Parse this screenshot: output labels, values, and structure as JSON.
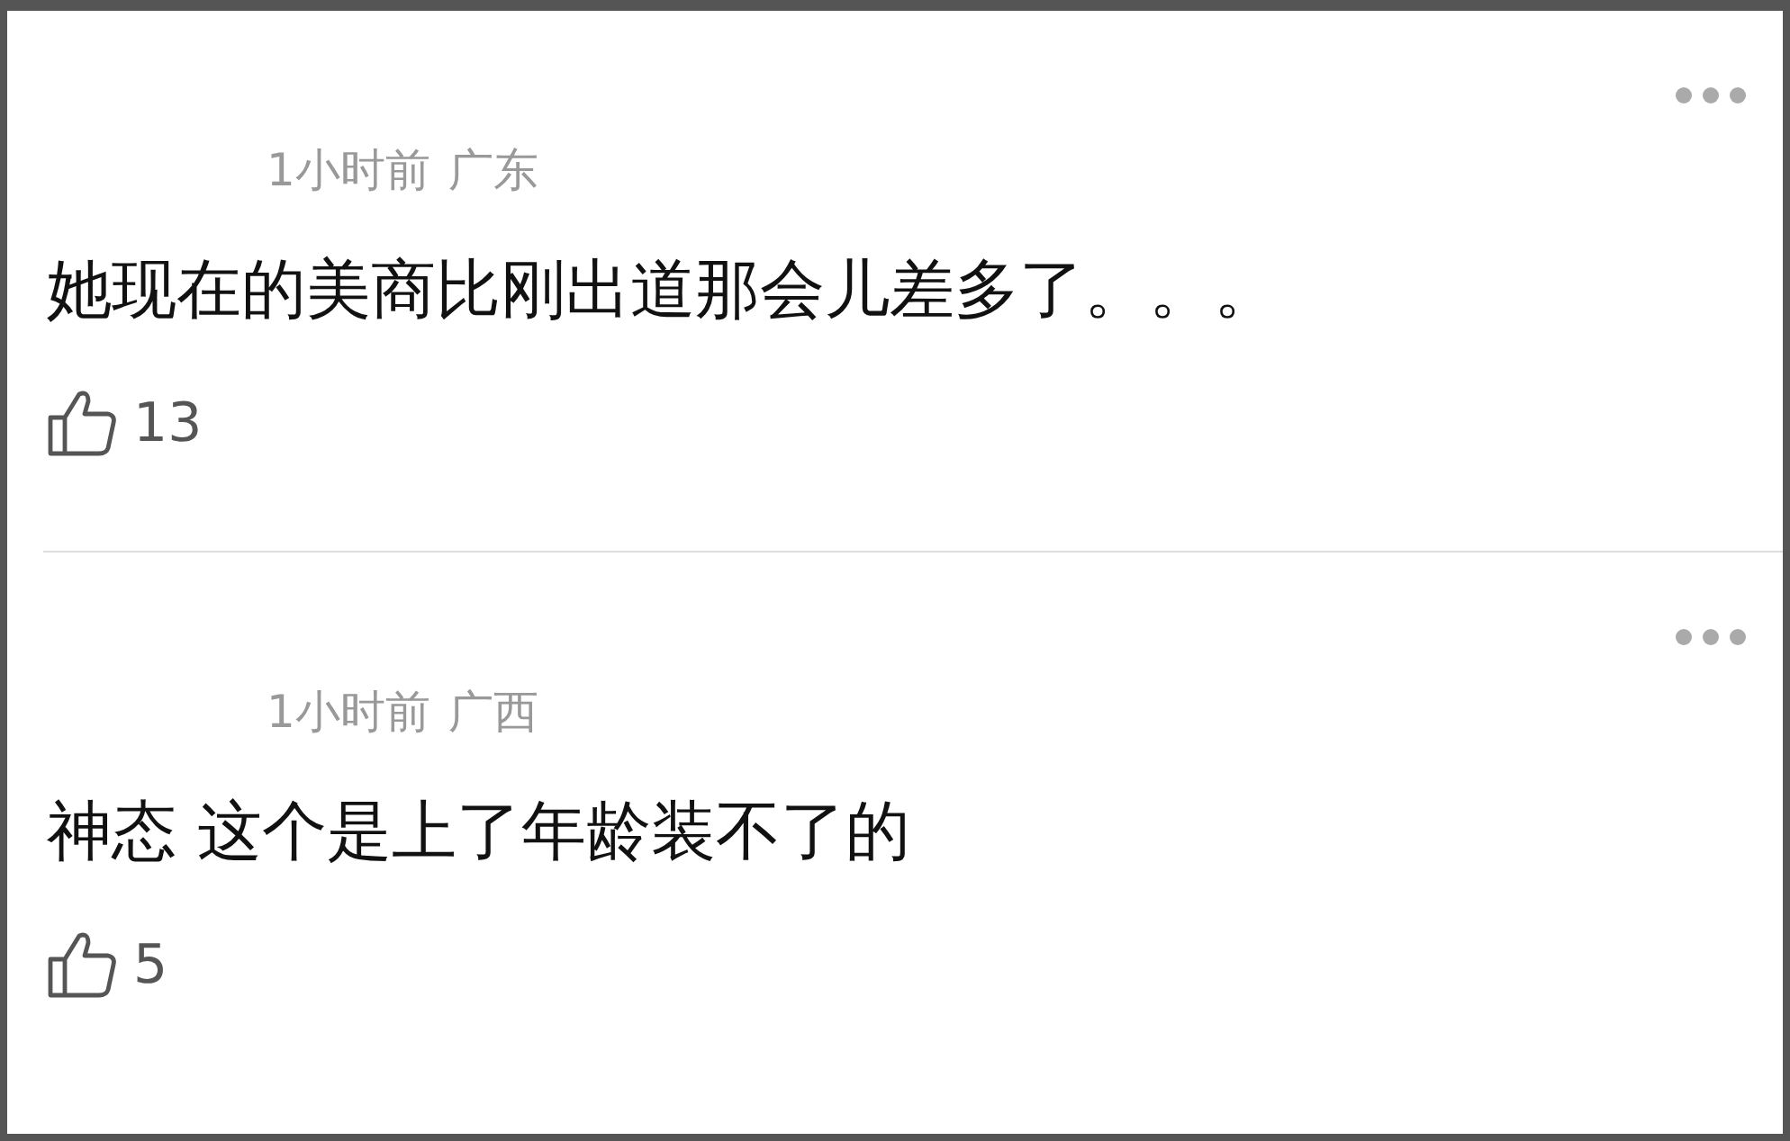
{
  "comments": [
    {
      "time": "1小时前",
      "location": "广东",
      "text": "她现在的美商比刚出道那会儿差多了。。。",
      "likes": "13"
    },
    {
      "time": "1小时前",
      "location": "广西",
      "text": "神态 这个是上了年龄装不了的",
      "likes": "5"
    }
  ]
}
